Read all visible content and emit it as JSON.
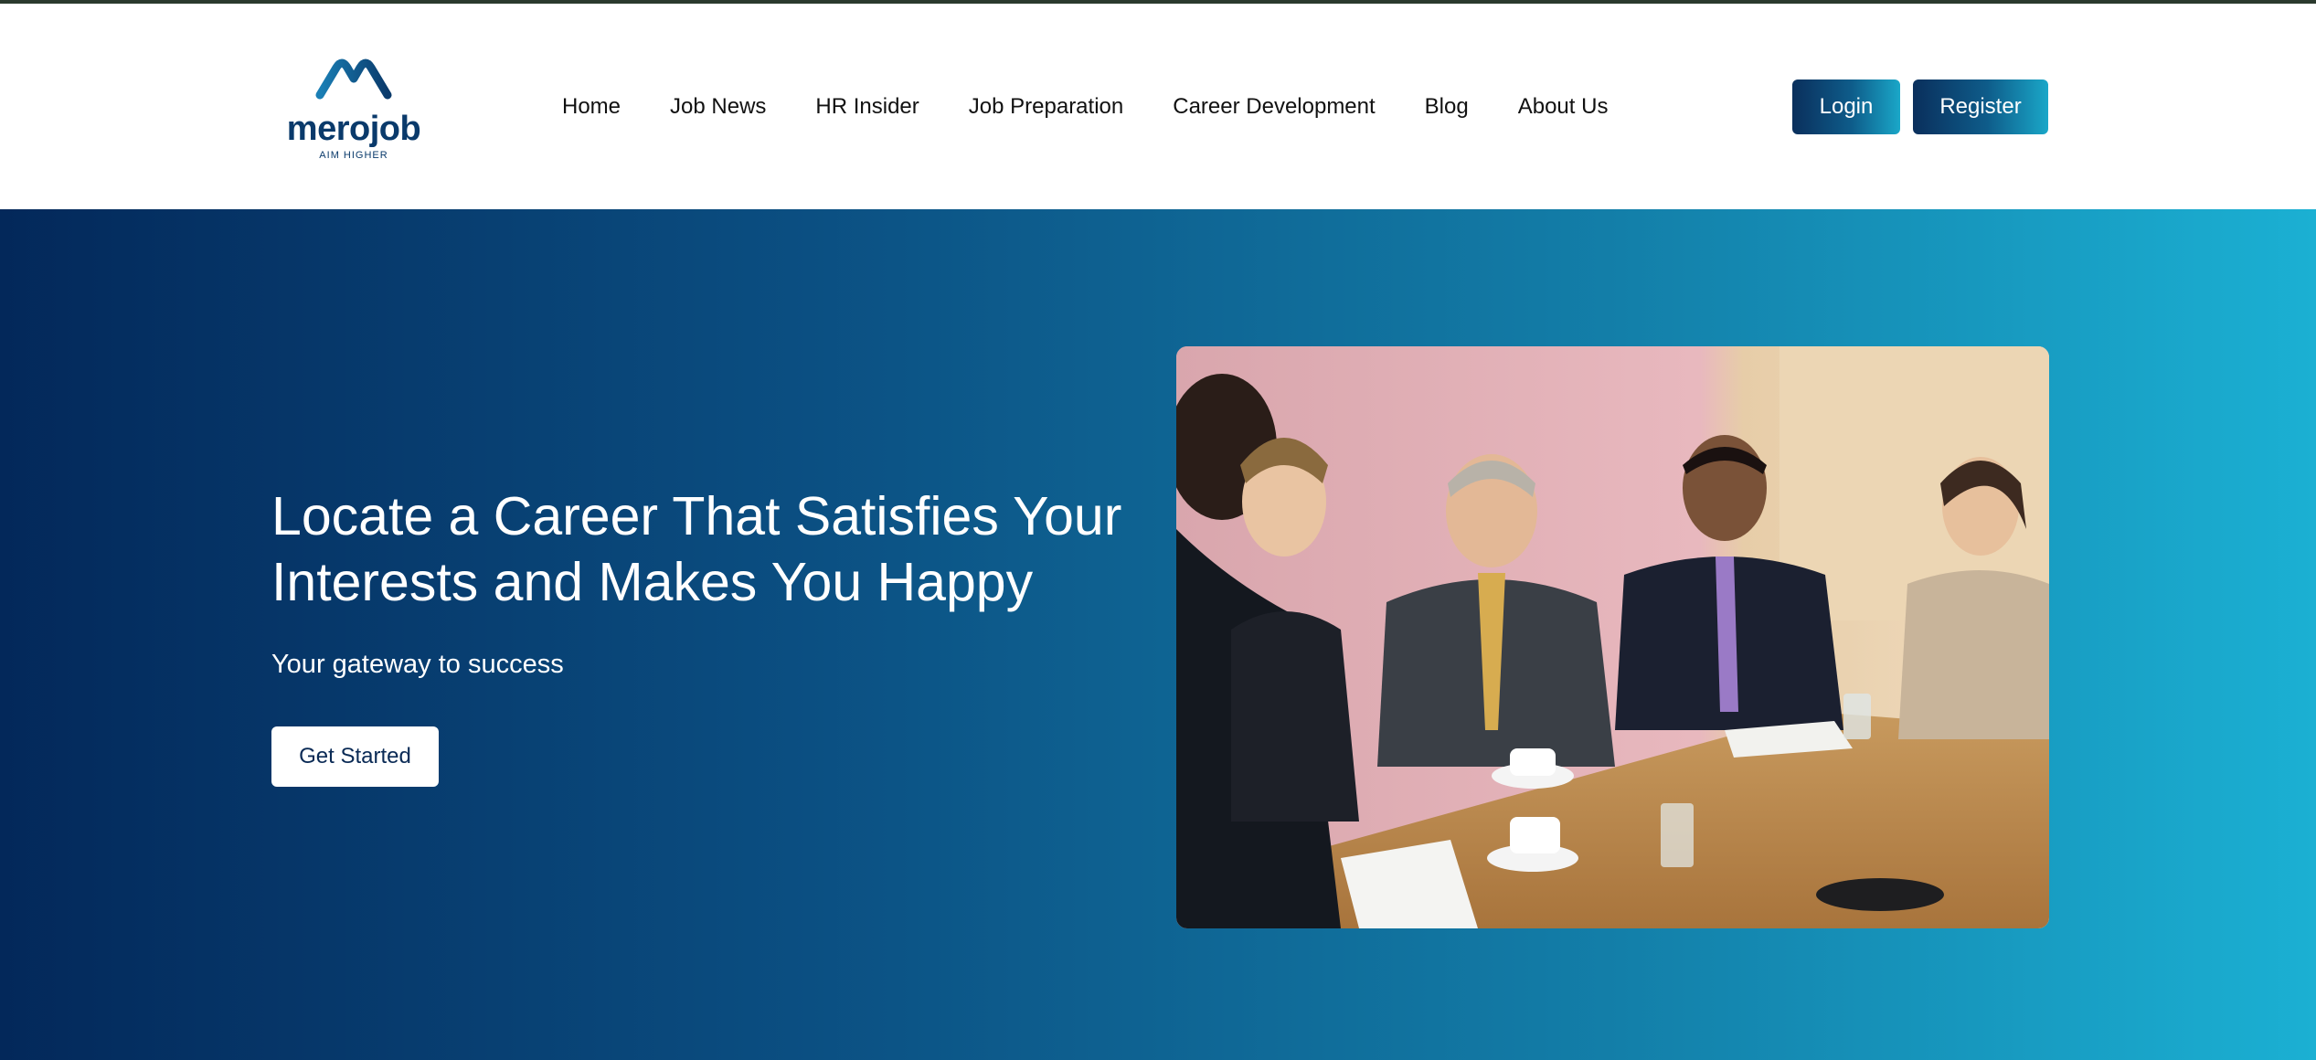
{
  "brand": {
    "name": "merojob",
    "tagline": "AIM HIGHER",
    "primary_color": "#0a3a6b",
    "accent_color": "#1aa7c8"
  },
  "nav": {
    "items": [
      {
        "label": "Home"
      },
      {
        "label": "Job News"
      },
      {
        "label": "HR Insider"
      },
      {
        "label": "Job Preparation"
      },
      {
        "label": "Career Development"
      },
      {
        "label": "Blog"
      },
      {
        "label": "About Us"
      }
    ]
  },
  "auth": {
    "login_label": "Login",
    "register_label": "Register"
  },
  "hero": {
    "title": "Locate a Career That Satisfies Your Interests and Makes You Happy",
    "subtitle": "Your gateway to success",
    "cta_label": "Get Started",
    "image_icon": "business-meeting-photo"
  }
}
